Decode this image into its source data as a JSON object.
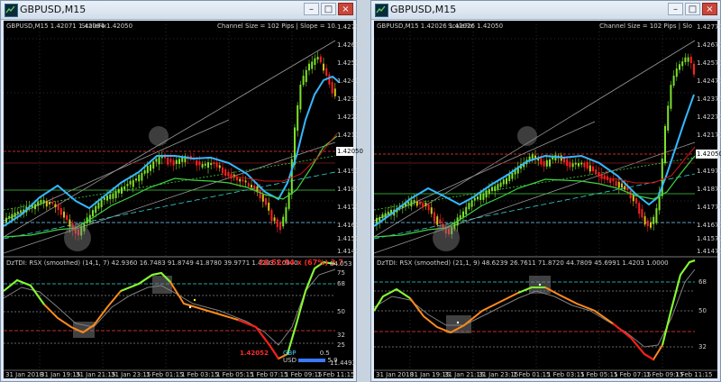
{
  "windows": [
    {
      "title": "GBPUSD,M15",
      "main_header": "GBPUSD,M15  1.42071 1.42084 1.42050",
      "scale_label": "ScaleFix",
      "channel_text": "Channel Size = 102 Pips  |  Slope = 10.",
      "price_ticks": [
        "1.42770",
        "1.42670",
        "1.42570",
        "1.42470",
        "1.42370",
        "1.42270",
        "1.42170",
        "1.41970",
        "1.41870",
        "1.41770",
        "1.41670",
        "1.41570",
        "1.41470"
      ],
      "price_box": "1.42050",
      "sub_header": "DzTDI:  RSX (smoothed) (14,1, 7) 42.9360 16.7483 91.8749 41.8780 39.9771 1.4203 1.0000",
      "timer": "26:52:54 x (67%) 2.7",
      "sub_ticks": [
        "84.053",
        "75",
        "68",
        "50",
        "32",
        "25",
        "11.4493"
      ],
      "red_label": "1.42052",
      "currency_rows": [
        {
          "name": "GBP",
          "value": "0.5"
        },
        {
          "name": "USD",
          "value": "5.9"
        }
      ],
      "time_axis": [
        "31 Jan 2018",
        "31 Jan 19:15",
        "31 Jan 21:15",
        "31 Jan 23:15",
        "1 Feb 01:15",
        "1 Feb 03:15",
        "1 Feb 05:15",
        "1 Feb 07:15",
        "1 Feb 09:15",
        "1 Feb 11:15"
      ]
    },
    {
      "title": "GBPUSD,M15",
      "main_header": "GBPUSD,M15  1.42026 1.42026 1.42050",
      "scale_label": "ScaleFix",
      "channel_text": "Channel Size = 102 Pips  |  Slo",
      "price_ticks": [
        "1.42770",
        "1.42670",
        "1.42570",
        "1.42470",
        "1.42370",
        "1.42270",
        "1.42170",
        "1.41970",
        "1.41870",
        "1.41770",
        "1.41670",
        "1.41570",
        "1.41470"
      ],
      "price_box": "1.42050",
      "sub_header": "DzTDI:  RSX (smoothed) (21,1, 9) 48.6239 26.7611 71.8720 44.7809 45.6991 1.4203 1.0000",
      "sub_ticks": [
        "68",
        "50",
        "32"
      ],
      "time_axis": [
        "31 Jan 2018",
        "31 Jan 19:15",
        "31 Jan 21:15",
        "31 Jan 23:15",
        "1 Feb 01:15",
        "1 Feb 03:15",
        "1 Feb 05:15",
        "1 Feb 07:15",
        "1 Feb 09:15",
        "1 Feb 11:15"
      ]
    }
  ],
  "window_buttons": {
    "minimize": "–",
    "maximize": "□",
    "close": "×"
  },
  "colors": {
    "bull": "#7de02a",
    "bear": "#ff2020",
    "neutral": "#d9c21a",
    "ma_blue": "#35b8ff",
    "ma_green": "#3fd23f",
    "ma_red": "#d01515",
    "rsx_green": "#7dff33",
    "rsx_orange": "#ff8a1a"
  }
}
